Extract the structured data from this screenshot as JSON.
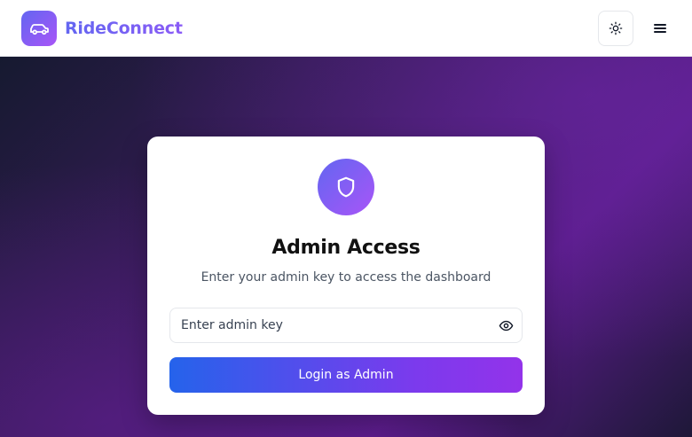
{
  "header": {
    "brand_name": "RideConnect",
    "brand_icon": "car-icon",
    "theme_toggle_icon": "sun-icon",
    "menu_icon": "hamburger-menu-icon"
  },
  "login_card": {
    "icon": "shield-icon",
    "title": "Admin Access",
    "subtitle": "Enter your admin key to access the dashboard",
    "key_input": {
      "placeholder": "Enter admin key",
      "value": "",
      "visibility_icon": "eye-icon"
    },
    "submit_label": "Login as Admin"
  },
  "colors": {
    "accent_start": "#2563eb",
    "accent_end": "#9333ea",
    "brand_gradient_start": "#6366f1",
    "brand_gradient_end": "#a855f7",
    "hero_background": "#3a1c5c"
  }
}
